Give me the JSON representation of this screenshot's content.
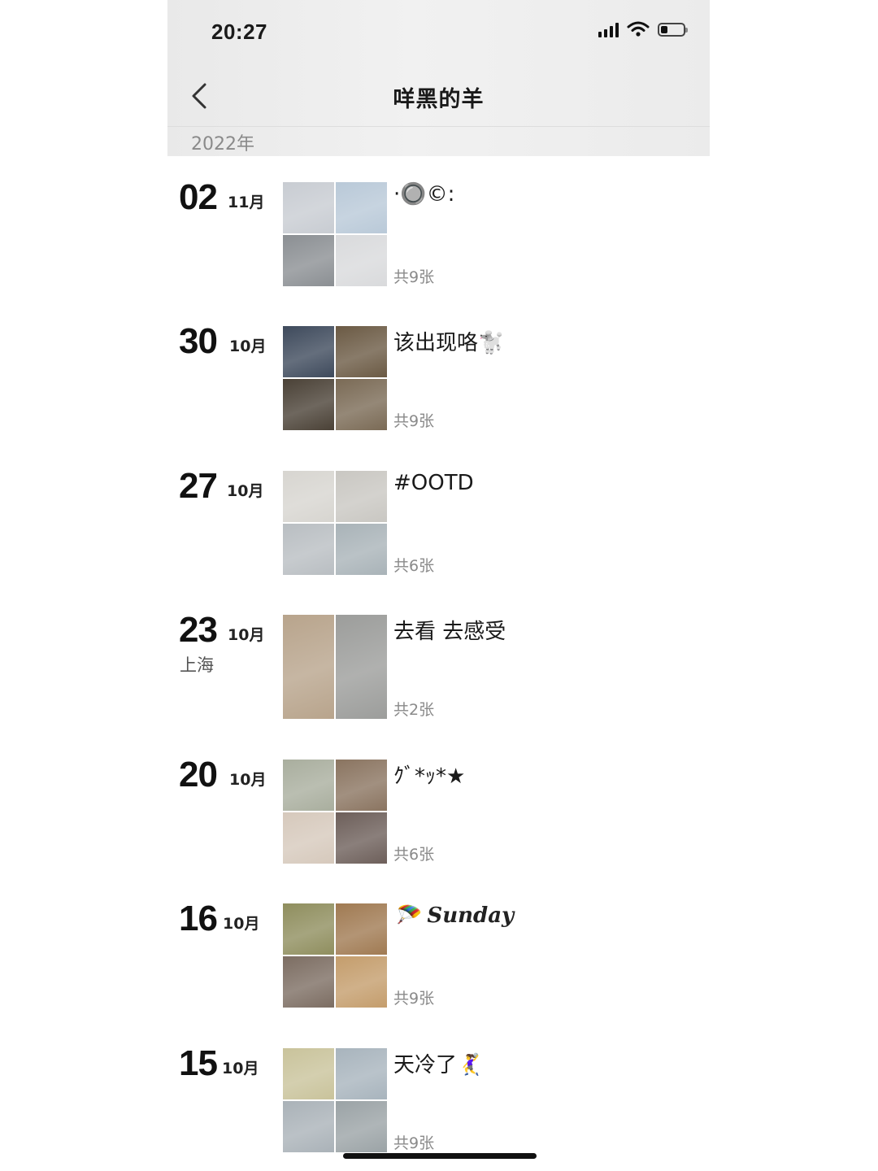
{
  "status_bar": {
    "time": "20:27"
  },
  "nav": {
    "title": "咩黑的羊"
  },
  "year": "2022年",
  "posts": [
    {
      "day": "02",
      "month": "11月",
      "location": "",
      "caption": "·🔘©:",
      "count": "共9张",
      "thumbs": [
        "#c8ccd2",
        "#b9c9d8",
        "#8b8f93",
        "#d9dadc"
      ]
    },
    {
      "day": "30",
      "month": "10月",
      "location": "",
      "caption": "该出现咯🐩",
      "count": "共9张",
      "thumbs": [
        "#3e4a5c",
        "#6b5a44",
        "#4a4136",
        "#7a6a55"
      ]
    },
    {
      "day": "27",
      "month": "10月",
      "location": "",
      "caption": "#OOTD",
      "count": "共6张",
      "thumbs": [
        "#d7d5d0",
        "#c9c7c2",
        "#b9bec2",
        "#a9b3b8"
      ]
    },
    {
      "day": "23",
      "month": "10月",
      "location": "上海",
      "caption": "去看 去感受",
      "count": "共2张",
      "thumbs": [
        "#b8a48c",
        "#9c9d9b"
      ]
    },
    {
      "day": "20",
      "month": "10月",
      "location": "",
      "caption": "ｸﾞ*ｯ*★",
      "count": "共6张",
      "thumbs": [
        "#a9ae9e",
        "#8a7460",
        "#d6c9bc",
        "#6d5f5a"
      ]
    },
    {
      "day": "16",
      "month": "10月",
      "location": "",
      "caption": "🪂 Sunday",
      "count": "共9张",
      "thumbs": [
        "#8f8e5e",
        "#a07a52",
        "#7c6d62",
        "#c49d6c"
      ]
    },
    {
      "day": "15",
      "month": "10月",
      "location": "",
      "caption": "天冷了🤾‍♀️",
      "count": "共9张",
      "thumbs": [
        "#c9c39b",
        "#a8b4bd",
        "#aab2b8",
        "#9ba3a6"
      ]
    }
  ]
}
